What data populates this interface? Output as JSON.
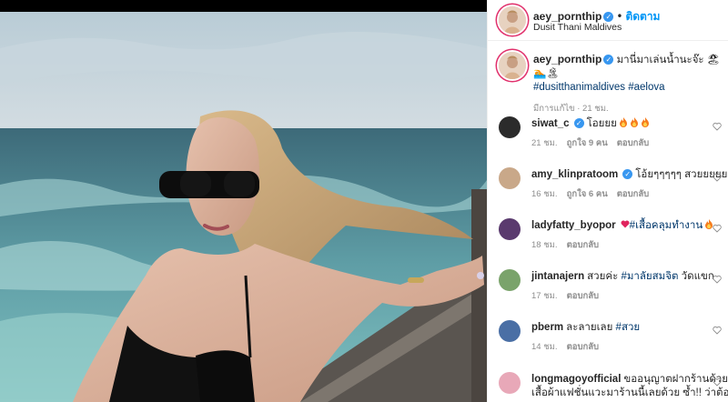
{
  "post": {
    "author": "aey_pornthip",
    "follow_label": "ติดตาม",
    "location": "Dusit Thani Maldives",
    "caption_text": "มานี่มาเล่นน้ำนะจ๊ะ",
    "caption_hashtags": "#dusitthanimaldives #aelova",
    "caption_meta": "มีการแก้ไข · 21 ชม."
  },
  "comments": [
    {
      "user": "siwat_c",
      "verified": true,
      "text": "โอยยย",
      "emoji": [
        "fire",
        "fire",
        "fire"
      ],
      "time": "21 ชม.",
      "likes": "ถูกใจ 9 คน",
      "reply": "ตอบกลับ",
      "avatar_color": "#2b2b2b"
    },
    {
      "user": "amy_klinpratoom",
      "verified": true,
      "text": "โอ้ยๆๆๆๆๆ สวยยยยยยยยย",
      "emoji": [],
      "time": "16 ชม.",
      "likes": "ถูกใจ 6 คน",
      "reply": "ตอบกลับ",
      "avatar_color": "#c9a889"
    },
    {
      "user": "ladyfatty_byopor",
      "verified": false,
      "text": "#เสื้อคลุมทำงาน",
      "emoji": [
        "heart",
        "fire"
      ],
      "time": "18 ชม.",
      "likes": "",
      "reply": "ตอบกลับ",
      "avatar_color": "#5a3a6e"
    },
    {
      "user": "jintanajern",
      "verified": false,
      "text": "สวยค่ะ #มาลัยสมจิต วัดแขก",
      "emoji": [],
      "time": "17 ชม.",
      "likes": "",
      "reply": "ตอบกลับ",
      "avatar_color": "#7aa36b"
    },
    {
      "user": "pberm",
      "verified": false,
      "text": "ละลายเลย #สวย",
      "emoji": [],
      "time": "14 ชม.",
      "likes": "",
      "reply": "ตอบกลับ",
      "avatar_color": "#4a6fa5"
    },
    {
      "user": "longmagoyofficial",
      "verified": false,
      "text": "ขออนุญาตฝากร้านด้วย",
      "text2": "เสื้อผ้าแฟชั่นแวะมาร้านนี้เลยด้วย ซ้ำ!! ว่าต้องร้านนี้",
      "emoji": [],
      "time": "",
      "likes": "",
      "reply": "",
      "avatar_color": "#e8a8b8"
    }
  ],
  "colors": {
    "link": "#00376b",
    "accent": "#0095f6",
    "verified": "#3897f0",
    "muted": "#8e8e8e"
  }
}
